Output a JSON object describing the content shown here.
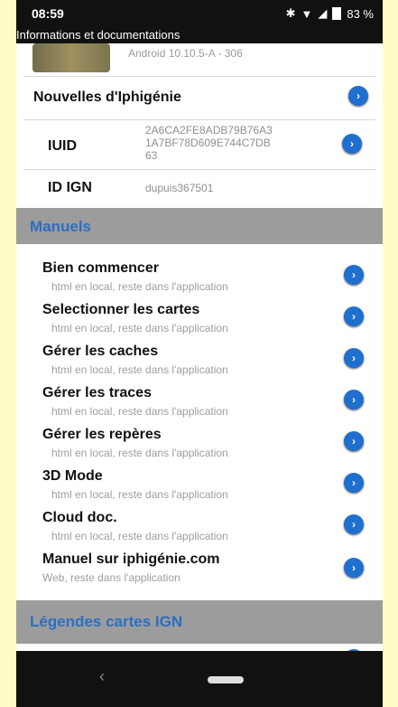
{
  "status": {
    "time": "08:59",
    "battery": "83 %"
  },
  "title": "Informations et documentations",
  "top": {
    "partial_text": "Android 10.10.5-A - 306"
  },
  "news": {
    "label": "Nouvelles d'Iphigénie"
  },
  "iuid": {
    "label": "IUID",
    "value_lines": [
      "2A6CA2FE8ADB79B76A3",
      "1A7BF78D609E744C7DB",
      "63"
    ]
  },
  "ign": {
    "label": "ID IGN",
    "value": "dupuis367501"
  },
  "manuals": {
    "header": "Manuels",
    "items": [
      {
        "title": "Bien commencer",
        "sub": "html en local, reste dans l'application"
      },
      {
        "title": "Selectionner les cartes",
        "sub": "html en local, reste dans l'application"
      },
      {
        "title": "Gérer les caches",
        "sub": "html en local, reste dans l'application"
      },
      {
        "title": "Gérer les traces",
        "sub": "html en local, reste dans l'application"
      },
      {
        "title": "Gérer les repères",
        "sub": "html en local, reste dans l'application"
      },
      {
        "title": "3D Mode",
        "sub": "html en local, reste dans l'application"
      },
      {
        "title": "Cloud doc.",
        "sub": "html en local, reste dans l'application"
      },
      {
        "title": "Manuel sur iphigénie.com",
        "sub": "Web, reste dans l'application"
      }
    ]
  },
  "legend": {
    "header": "Légendes cartes IGN"
  },
  "icons": {
    "back": "back-icon",
    "home": "home-icon",
    "arrow": "chevron-right-icon",
    "wifi": "wifi-icon",
    "signal": "signal-icon",
    "bluetooth": "bluetooth-icon"
  },
  "colors": {
    "accent": "#1f6fcf",
    "section": "#2d6ec0",
    "background": "#9c9c9c"
  }
}
